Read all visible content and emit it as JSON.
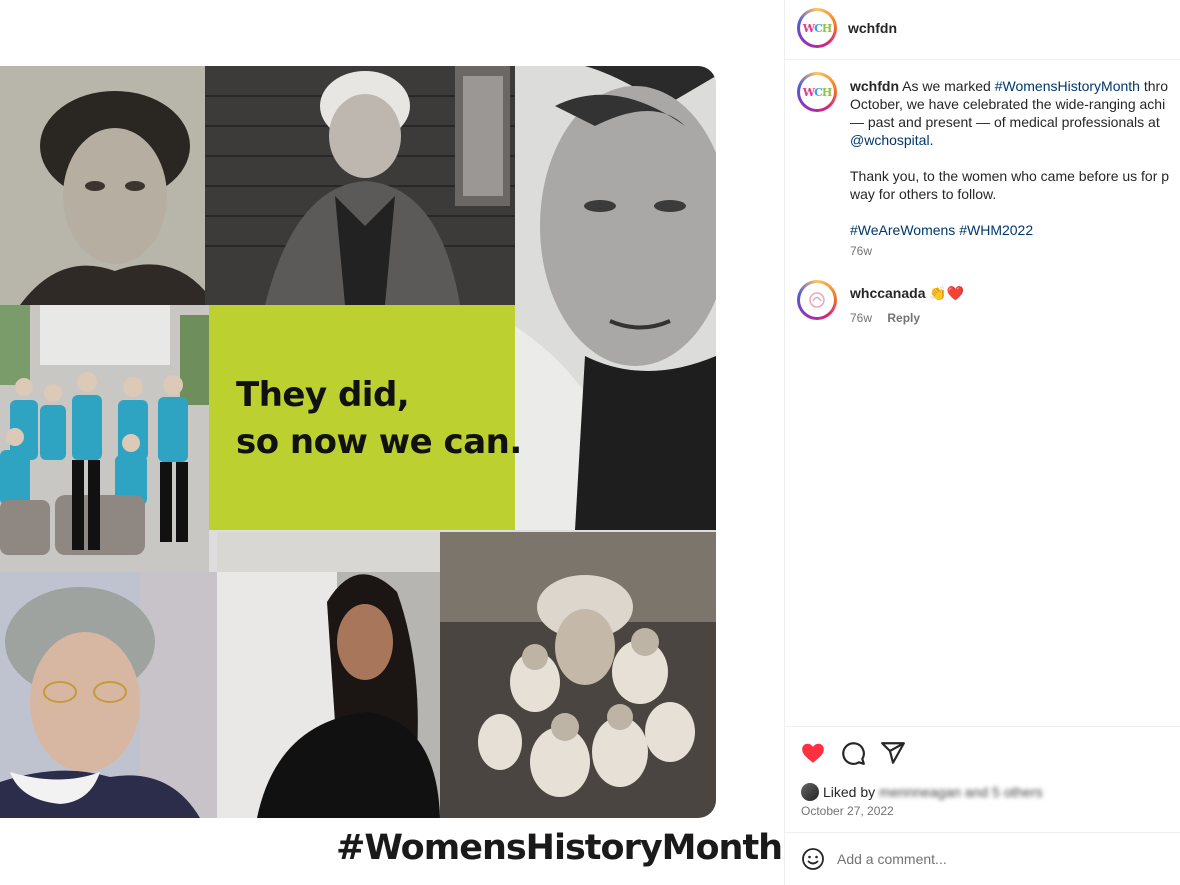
{
  "post_image": {
    "tagline_line_1": "They did,",
    "tagline_line_2": "so now we can.",
    "hashtag_caption": "#WomensHistoryMonth",
    "colors": {
      "panel": "#bcd02f"
    }
  },
  "header": {
    "username": "wchfdn",
    "logo": {
      "w": "W",
      "c": "C",
      "h": "H"
    }
  },
  "caption": {
    "username": "wchfdn",
    "line1_text": "As we marked ",
    "line1_hashtag": "#WomensHistoryMonth",
    "line1_tail": " thro",
    "line2": "October, we have celebrated the wide-ranging achi",
    "line3": "— past and present — of medical professionals at",
    "mention": "@wchospital",
    "mention_tail": ".",
    "para2_line1": "Thank you, to the women who came before us for p",
    "para2_line2": "way for others to follow.",
    "hashtag1": "#WeAreWomens",
    "hashtag2": "#WHM2022",
    "time": "76w"
  },
  "comment": {
    "username": "whccanada",
    "text": "👏❤️",
    "time": "76w",
    "reply": "Reply"
  },
  "actions": {
    "icons": [
      "heart-icon",
      "comment-icon",
      "share-icon"
    ],
    "like_color": "#ff3040"
  },
  "likes": {
    "prefix": "Liked by",
    "blurred": "mennneagan and 5 others"
  },
  "date": "October 27, 2022",
  "add_comment": {
    "placeholder": "Add a comment..."
  }
}
